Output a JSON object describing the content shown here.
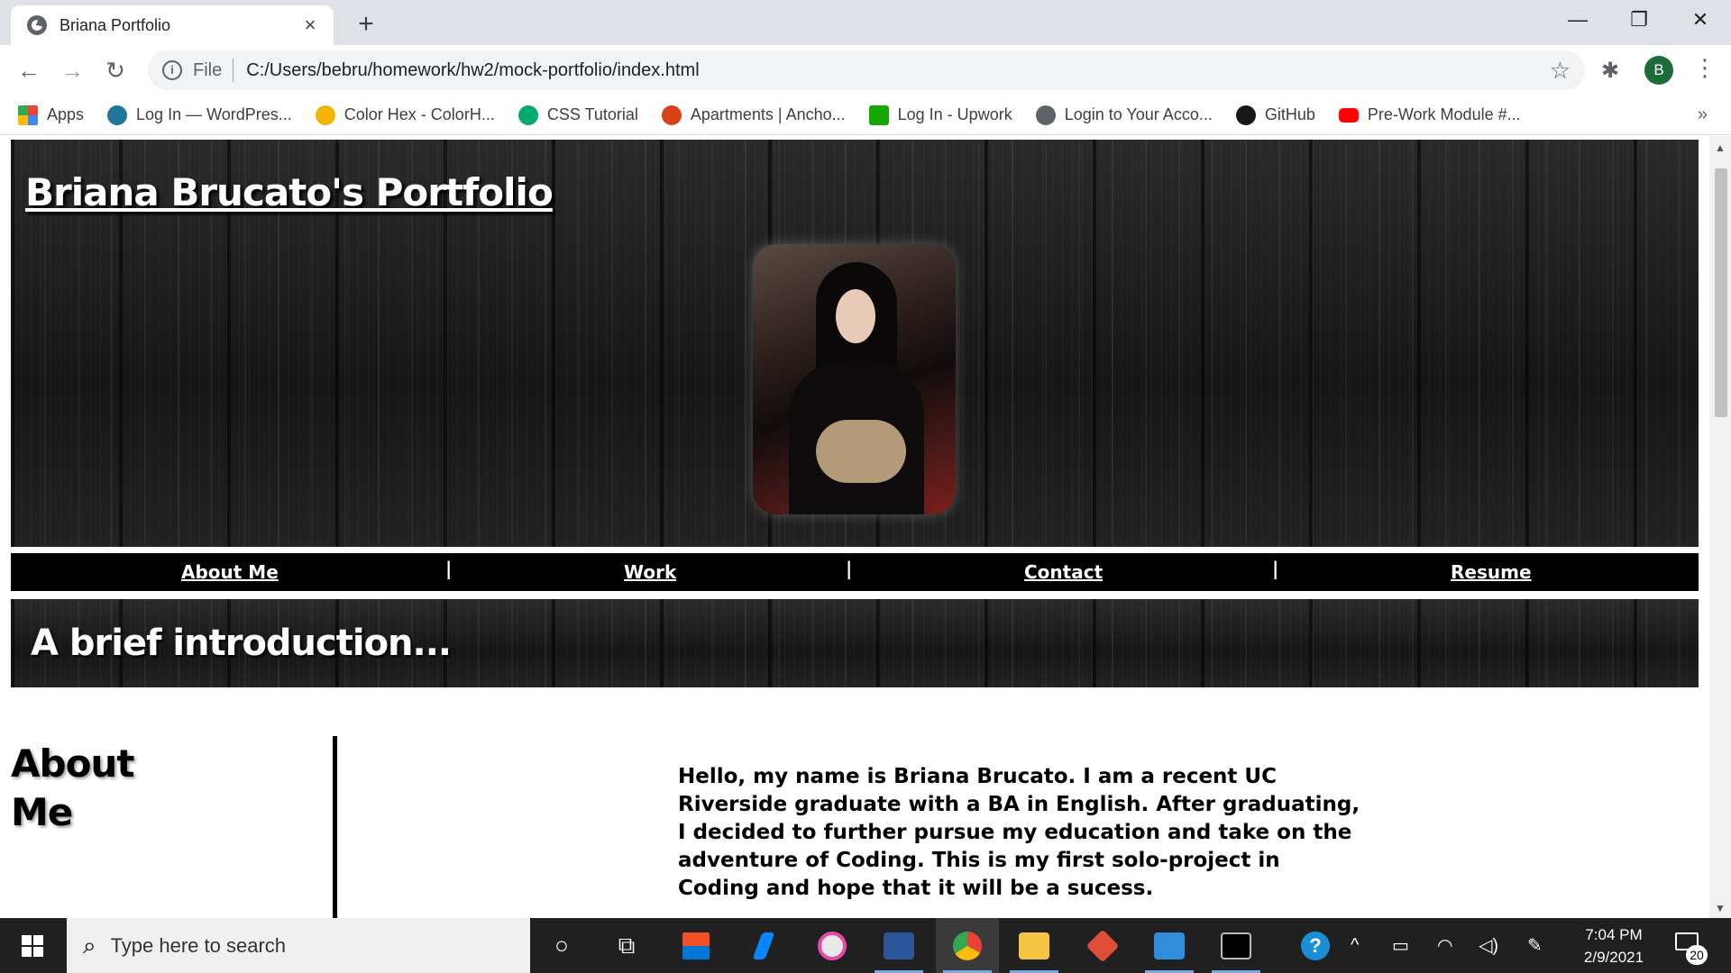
{
  "browser": {
    "tab_title": "Briana Portfolio",
    "tab_close": "×",
    "new_tab": "+",
    "window_minimize": "—",
    "window_restore": "❐",
    "window_close": "✕",
    "back": "←",
    "forward": "→",
    "reload": "↻",
    "info": "i",
    "url_scheme_label": "File",
    "url": "C:/Users/bebru/homework/hw2/mock-portfolio/index.html",
    "bookmark_star": "☆",
    "extensions": "✱",
    "profile_initial": "B",
    "menu": "⋮",
    "bookmarks": [
      {
        "label": "Apps",
        "icon": "apps-grid-icon",
        "color": "#ea4335"
      },
      {
        "label": "Log In — WordPres...",
        "icon": "wordpress-icon",
        "color": "#21759b"
      },
      {
        "label": "Color Hex - ColorH...",
        "icon": "colorhex-icon",
        "color": "#f4b400"
      },
      {
        "label": "CSS Tutorial",
        "icon": "w3schools-icon",
        "color": "#04aa6d"
      },
      {
        "label": "Apartments | Ancho...",
        "icon": "apartments-icon",
        "color": "#d84315"
      },
      {
        "label": "Log In - Upwork",
        "icon": "upwork-icon",
        "color": "#14a800"
      },
      {
        "label": "Login to Your Acco...",
        "icon": "globe-icon",
        "color": "#5f6368"
      },
      {
        "label": "GitHub",
        "icon": "github-icon",
        "color": "#181717"
      },
      {
        "label": "Pre-Work Module #...",
        "icon": "youtube-icon",
        "color": "#ff0000"
      }
    ],
    "bookmarks_more": "»"
  },
  "page": {
    "site_title": "Briana Brucato's Portfolio",
    "nav": [
      {
        "label": "About Me"
      },
      {
        "label": "Work"
      },
      {
        "label": "Contact"
      },
      {
        "label": "Resume"
      }
    ],
    "nav_separator": "|",
    "intro_title": "A brief introduction...",
    "about_heading_line1": "About",
    "about_heading_line2": "Me",
    "about_text": "Hello, my name is Briana Brucato. I am a recent UC Riverside graduate with a BA in English. After graduating, I decided to further pursue my education and take on the adventure of Coding. This is my first solo-project in Coding and hope that it will be a sucess."
  },
  "scrollbar": {
    "up": "▲",
    "down": "▼"
  },
  "taskbar": {
    "search_placeholder": "Type here to search",
    "search_icon": "⌕",
    "cortana": "○",
    "taskview": "⧉",
    "help": "?",
    "tray_up": "^",
    "battery": "▭",
    "wifi": "◠",
    "volume": "◁)",
    "pen": "✎",
    "time": "7:04 PM",
    "date": "2/9/2021",
    "notifications_count": "20"
  }
}
